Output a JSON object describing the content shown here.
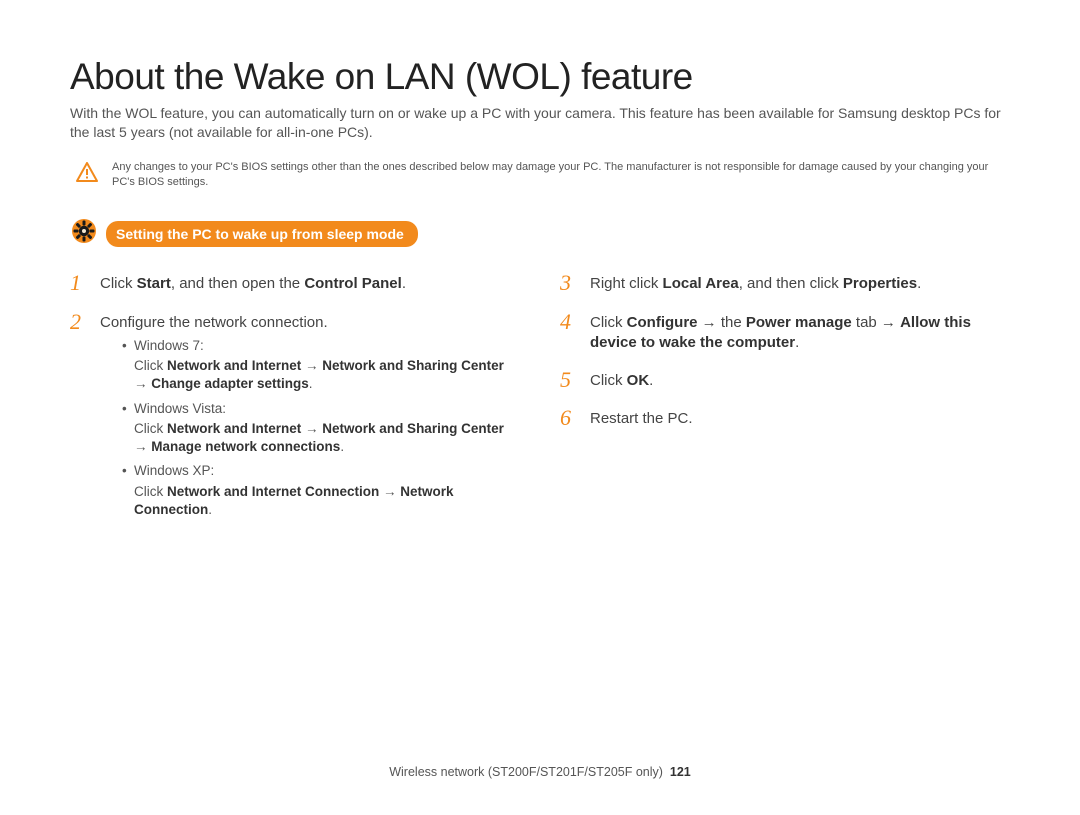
{
  "title": "About the Wake on LAN (WOL) feature",
  "intro": "With the WOL feature, you can automatically turn on or wake up a PC with your camera. This feature has been available for Samsung desktop PCs for the last 5 years (not available for all-in-one PCs).",
  "caution": "Any changes to your PC's BIOS settings other than the ones described below may damage your PC. The manufacturer is not responsible for damage caused by your changing your PC's BIOS settings.",
  "section_heading": "Setting the PC to wake up from sleep mode",
  "left_steps": [
    {
      "num": "1",
      "html": "Click <b>Start</b>, and then open the <b>Control Panel</b>."
    },
    {
      "num": "2",
      "html": "Configure the network connection.",
      "sub": [
        {
          "lead": "Windows 7:",
          "detail_html": "Click <b>Network and Internet</b> → <b>Network and Sharing Center</b> → <b>Change adapter settings</b>."
        },
        {
          "lead": "Windows Vista:",
          "detail_html": "Click <b>Network and Internet</b> → <b>Network and Sharing Center</b> → <b>Manage network connections</b>."
        },
        {
          "lead": "Windows XP:",
          "detail_html": "Click <b>Network and Internet Connection</b> → <b>Network Connection</b>."
        }
      ]
    }
  ],
  "right_steps": [
    {
      "num": "3",
      "html": "Right click <b>Local Area</b>, and then click <b>Properties</b>."
    },
    {
      "num": "4",
      "html": "Click <b>Configure</b> → the <b>Power manage</b> tab → <b>Allow this device to wake the computer</b>."
    },
    {
      "num": "5",
      "html": "Click <b>OK</b>."
    },
    {
      "num": "6",
      "html": "Restart the PC."
    }
  ],
  "footer": {
    "text": "Wireless network (ST200F/ST201F/ST205F only)",
    "page": "121"
  }
}
